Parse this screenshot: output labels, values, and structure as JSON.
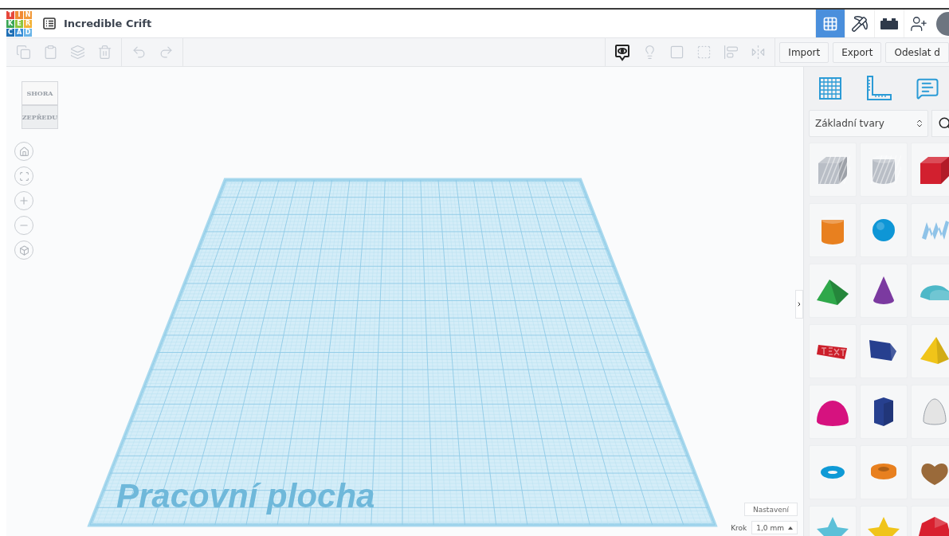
{
  "logo": {
    "cells": [
      {
        "letter": "T",
        "color": "#e6473b"
      },
      {
        "letter": "I",
        "color": "#f08a34"
      },
      {
        "letter": "N",
        "color": "#f29a3a"
      },
      {
        "letter": "K",
        "color": "#3aa655"
      },
      {
        "letter": "E",
        "color": "#8cc63f"
      },
      {
        "letter": "R",
        "color": "#f2b33a"
      },
      {
        "letter": "C",
        "color": "#1f6fb5"
      },
      {
        "letter": "A",
        "color": "#3a8fd6"
      },
      {
        "letter": "D",
        "color": "#6bb5e8"
      }
    ]
  },
  "project": {
    "title": "Incredible Crift"
  },
  "nav": [
    {
      "kind": "grid",
      "selected": true
    },
    {
      "kind": "pickaxe",
      "selected": false
    },
    {
      "kind": "brick",
      "selected": false
    },
    {
      "kind": "user-add",
      "selected": false
    }
  ],
  "toolbar": {
    "left": [
      {
        "kind": "copy",
        "disabled": true
      },
      {
        "kind": "paste",
        "disabled": true
      },
      {
        "kind": "duplicate",
        "disabled": true
      },
      {
        "kind": "delete",
        "disabled": true
      },
      {
        "kind": "undo",
        "disabled": true
      },
      {
        "kind": "redo",
        "disabled": true
      }
    ],
    "right": [
      {
        "kind": "notes",
        "disabled": false
      },
      {
        "kind": "bulb",
        "disabled": true
      },
      {
        "kind": "group",
        "disabled": true
      },
      {
        "kind": "ungroup",
        "disabled": true
      },
      {
        "kind": "align",
        "disabled": true
      },
      {
        "kind": "mirror",
        "disabled": true
      }
    ],
    "buttons": [
      "Import",
      "Export",
      "Odeslat d"
    ]
  },
  "viewcube": {
    "top": "SHORA",
    "front": "ZEPŘEDU"
  },
  "view_controls": [
    {
      "kind": "home"
    },
    {
      "kind": "fit"
    },
    {
      "kind": "zoom-in"
    },
    {
      "kind": "zoom-out"
    },
    {
      "kind": "perspective"
    }
  ],
  "workplane": {
    "label": "Pracovní plocha"
  },
  "settings": {
    "button": "Nastavení",
    "step_label": "Krok",
    "step_value": "1,0 mm"
  },
  "sidebar": {
    "tools": [
      {
        "kind": "grid"
      },
      {
        "kind": "ruler"
      },
      {
        "kind": "notes"
      }
    ],
    "category": "Základní tvary",
    "shapes": [
      {
        "kind": "box-hole",
        "color": "#b9bec6"
      },
      {
        "kind": "cylinder-hole",
        "color": "#b9bec6"
      },
      {
        "kind": "box",
        "color": "#d2202f"
      },
      {
        "kind": "cylinder",
        "color": "#e8801f"
      },
      {
        "kind": "sphere",
        "color": "#0e96d6"
      },
      {
        "kind": "scribble",
        "color": "#8fc3e8"
      },
      {
        "kind": "roof",
        "color": "#2fa84a"
      },
      {
        "kind": "cone",
        "color": "#7b3aa0"
      },
      {
        "kind": "round-roof",
        "color": "#4db8c8"
      },
      {
        "kind": "text",
        "color": "#cc1f2b"
      },
      {
        "kind": "polygon",
        "color": "#27408f"
      },
      {
        "kind": "pyramid",
        "color": "#f0c419"
      },
      {
        "kind": "half-sphere",
        "color": "#d6127f"
      },
      {
        "kind": "hexagon",
        "color": "#27408f"
      },
      {
        "kind": "paraboloid",
        "color": "#e4e4e4"
      },
      {
        "kind": "torus",
        "color": "#0f9ad6"
      },
      {
        "kind": "tube",
        "color": "#e8801f"
      },
      {
        "kind": "heart",
        "color": "#9a6a3a"
      },
      {
        "kind": "star",
        "color": "#5cc0d8"
      },
      {
        "kind": "star",
        "color": "#f0c419"
      },
      {
        "kind": "icosphere",
        "color": "#d8202f"
      }
    ]
  }
}
